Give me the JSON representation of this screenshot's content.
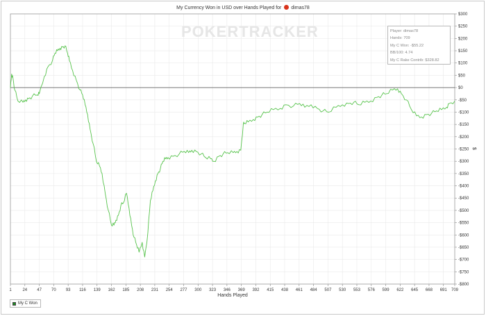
{
  "title_prefix": "My Currency Won in USD over Hands Played for",
  "player": "dimas78",
  "watermark": "POKERTRACKER",
  "stats": [
    "Player: dimas78",
    "Hands: 709",
    "My C Won: -$55.22",
    "BB/100: 4.74",
    "My C Rake Contrib: $328.82"
  ],
  "legend_label": "My C Won",
  "colors": {
    "line": "#55c24a",
    "zero_line": "#4d4d4d",
    "grid": "#e9e9e9",
    "flag": "#d9341c",
    "legend_swatch": "#1f8a24"
  },
  "chart_data": {
    "type": "line",
    "title": "My Currency Won in USD over Hands Played for dimas78",
    "xlabel": "Hands Played",
    "ylabel": "$",
    "xlim": [
      1,
      709
    ],
    "ylim": [
      -800,
      300
    ],
    "x_ticks": [
      1,
      24,
      47,
      70,
      93,
      116,
      139,
      162,
      185,
      208,
      231,
      254,
      277,
      300,
      323,
      346,
      369,
      392,
      415,
      438,
      461,
      484,
      507,
      530,
      553,
      576,
      599,
      622,
      645,
      668,
      691,
      709
    ],
    "y_ticks": [
      300,
      250,
      200,
      150,
      100,
      50,
      0,
      -50,
      -100,
      -150,
      -200,
      -250,
      -300,
      -350,
      -400,
      -450,
      -500,
      -550,
      -600,
      -650,
      -700,
      -750,
      -800
    ],
    "y_tick_labels": [
      "$300",
      "$250",
      "$200",
      "$150",
      "$100",
      "$50",
      "$0",
      "-$50",
      "-$100",
      "-$150",
      "-$200",
      "-$250",
      "-$300",
      "-$350",
      "-$400",
      "-$450",
      "-$500",
      "-$550",
      "-$600",
      "-$650",
      "-$700",
      "-$750",
      "-$800"
    ],
    "grid": true,
    "legend_position": "bottom-left",
    "series": [
      {
        "name": "My C Won",
        "x": [
          1,
          3,
          5,
          8,
          13,
          21,
          25,
          30,
          36,
          44,
          47,
          55,
          61,
          68,
          72,
          76,
          80,
          84,
          88,
          92,
          95,
          100,
          106,
          112,
          116,
          120,
          124,
          128,
          133,
          138,
          143,
          147,
          152,
          157,
          162,
          166,
          169,
          173,
          177,
          181,
          186,
          190,
          194,
          198,
          202,
          206,
          211,
          215,
          220,
          224,
          228,
          232,
          236,
          240,
          244,
          248,
          252,
          260,
          270,
          278,
          285,
          290,
          297,
          305,
          312,
          320,
          325,
          333,
          340,
          347,
          356,
          362,
          368,
          372,
          374,
          380,
          388,
          395,
          402,
          410,
          420,
          431,
          440,
          452,
          462,
          470,
          480,
          490,
          499,
          508,
          520,
          530,
          540,
          548,
          556,
          566,
          575,
          585,
          593,
          600,
          610,
          618,
          624,
          632,
          640,
          648,
          656,
          664,
          672,
          680,
          688,
          696,
          700,
          709
        ],
        "y": [
          0,
          55,
          40,
          -10,
          -55,
          -60,
          -50,
          -45,
          -35,
          -30,
          -25,
          45,
          85,
          110,
          140,
          150,
          160,
          165,
          170,
          140,
          110,
          70,
          30,
          -10,
          -30,
          -70,
          -110,
          -170,
          -230,
          -300,
          -320,
          -350,
          -430,
          -500,
          -560,
          -560,
          -540,
          -520,
          -480,
          -470,
          -430,
          -490,
          -560,
          -610,
          -640,
          -670,
          -630,
          -690,
          -590,
          -460,
          -420,
          -380,
          -350,
          -330,
          -300,
          -290,
          -285,
          -280,
          -270,
          -260,
          -265,
          -255,
          -260,
          -270,
          -285,
          -290,
          -300,
          -280,
          -270,
          -265,
          -265,
          -260,
          -255,
          -150,
          -145,
          -140,
          -130,
          -120,
          -110,
          -100,
          -90,
          -85,
          -70,
          -75,
          -65,
          -80,
          -70,
          -85,
          -95,
          -100,
          -80,
          -70,
          -65,
          -60,
          -70,
          -60,
          -55,
          -40,
          -30,
          -25,
          -10,
          -5,
          -25,
          -50,
          -90,
          -115,
          -120,
          -110,
          -105,
          -95,
          -90,
          -80,
          -65,
          -55
        ]
      }
    ]
  }
}
